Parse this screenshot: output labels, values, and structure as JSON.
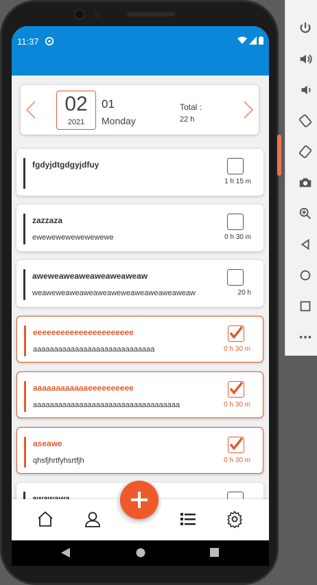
{
  "status_bar": {
    "time": "11:37"
  },
  "date_card": {
    "day": "02",
    "year": "2021",
    "month": "01",
    "weekday": "Monday",
    "total_label": "Total :",
    "total_value": "22 h"
  },
  "tasks": [
    {
      "title": "fgdyjdtgdgyjdfuy",
      "description": "",
      "duration": "1 h 15 m",
      "checked": false
    },
    {
      "title": "zazzaza",
      "description": "ewewewewewewewewe",
      "duration": "0 h 30 m",
      "checked": false
    },
    {
      "title": "aweweaweaweaweaweaweaw",
      "description": "weaweweaweaweaweaweweaweaweaweaweaw",
      "duration": "20 h",
      "checked": false
    },
    {
      "title": "eeeeeeeeeeeeeeeeeeeeee",
      "description": "aaaaaaaaaaaaaaaaaaaaaaaaaaaaa",
      "duration": "0 h 30 m",
      "checked": true
    },
    {
      "title": "aaaaaaaaaaaaeeeeeeeeee",
      "description": "aaaaaaaaaaaaaaaaaaaaaaaaaaaaaaaaaaa",
      "duration": "0 h 30 m",
      "checked": true
    },
    {
      "title": "aseawe",
      "description": "qhsfjhrtfyhsrtfjh",
      "duration": "0 h 30 m",
      "checked": true
    },
    {
      "title": "awawawa",
      "description": "",
      "duration": "",
      "checked": false
    }
  ],
  "colors": {
    "accent": "#ee5a2a",
    "header": "#0a87d8"
  },
  "icons": {
    "nav": [
      "home-icon",
      "profile-icon",
      "list-icon",
      "settings-icon"
    ],
    "fab": "plus-icon"
  }
}
